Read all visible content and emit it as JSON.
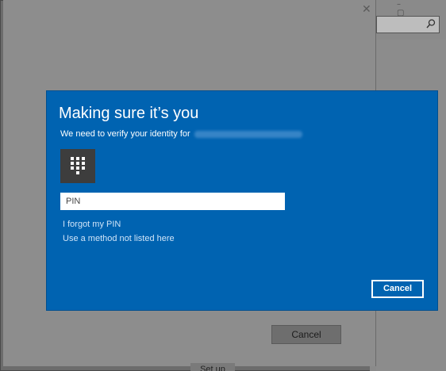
{
  "background_window": {
    "controls": "– ▢ ✕"
  },
  "pin_setup_dialog": {
    "close_glyph": "✕",
    "cancel_label": "Cancel",
    "setup_label": "Set up"
  },
  "security_dialog": {
    "title": "Making sure it’s you",
    "subtitle": "We need to verify your identity for",
    "pin_placeholder": "PIN",
    "forgot_link": "I forgot my PIN",
    "other_method_link": "Use a method not listed here",
    "cancel_label": "Cancel",
    "icon": "keypad-icon"
  },
  "colors": {
    "dialog_blue": "#0063b1",
    "link": "#cfe4f8",
    "tile": "#3d3d3d"
  }
}
